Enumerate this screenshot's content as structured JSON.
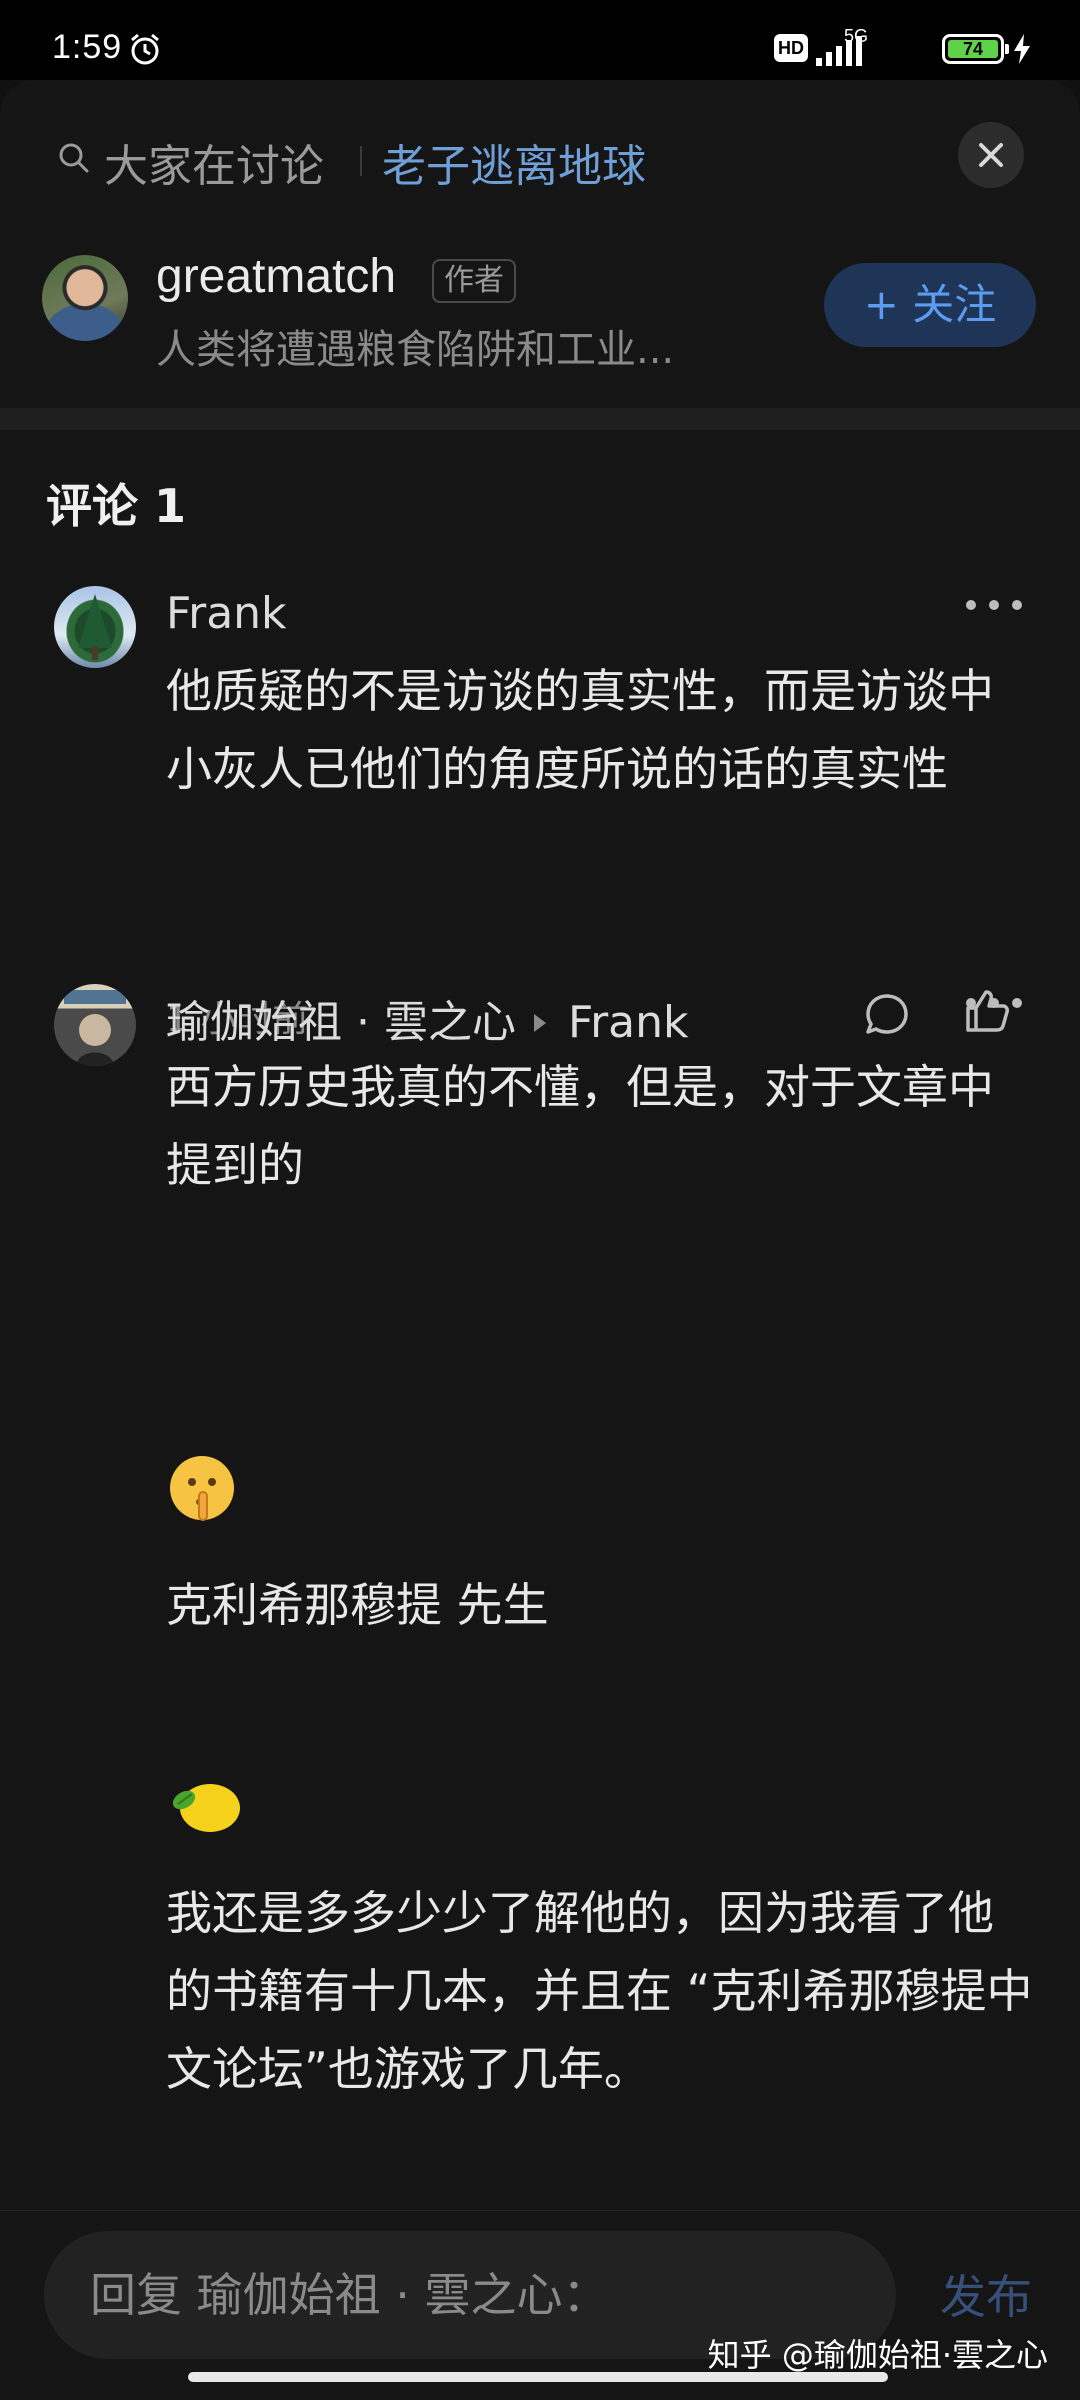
{
  "status_bar": {
    "time": "1:59",
    "hd_label": "HD",
    "network": "5G",
    "battery": "74"
  },
  "topic": {
    "prefix": "大家在讨论",
    "name": "老子逃离地球"
  },
  "author": {
    "name": "greatmatch",
    "badge": "作者",
    "description": "人类将遭遇粮食陷阱和工业...",
    "follow_label": "+ 关注"
  },
  "comments_header": "评论 1",
  "comments": [
    {
      "name": "Frank",
      "text": "他质疑的不是访谈的真实性，而是访谈中小灰人已他们的角度所说的话的真实性",
      "time": "1 小时前"
    },
    {
      "name": "瑜伽始祖 · 雲之心",
      "reply_to": "Frank",
      "paragraphs": [
        "西方历史我真的不懂，但是，对于文章中提到的",
        "克利希那穆提 先生",
        "我还是多多少少了解他的，因为我看了他的书籍有十几本，并且在 “克利希那穆提中文论坛”也游戏了几年。"
      ],
      "emojis": [
        "shushing-face",
        "lemon"
      ]
    }
  ],
  "reply_box": {
    "placeholder": "回复 瑜伽始祖 · 雲之心：",
    "publish_label": "发布"
  },
  "watermark": "知乎 @瑜伽始祖·雲之心",
  "colors": {
    "accent_blue": "#5c9cf0",
    "topic_blue": "#6f9fd6",
    "background": "#151515"
  }
}
